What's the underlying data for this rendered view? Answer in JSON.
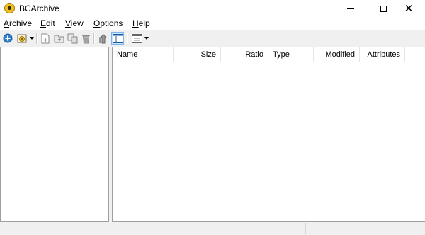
{
  "window": {
    "title": "BCArchive",
    "icon": "bcarchive-app-icon",
    "controls": [
      "minimize-icon",
      "maximize-icon",
      "close-icon"
    ]
  },
  "menu": {
    "items": [
      {
        "label": "Archive",
        "mnemonic": "A",
        "rest": "rchive"
      },
      {
        "label": "Edit",
        "mnemonic": "E",
        "rest": "dit"
      },
      {
        "label": "View",
        "mnemonic": "V",
        "rest": "iew"
      },
      {
        "label": "Options",
        "mnemonic": "O",
        "rest": "ptions"
      },
      {
        "label": "Help",
        "mnemonic": "H",
        "rest": "elp"
      }
    ]
  },
  "toolbar": {
    "buttons": [
      "new-archive-icon",
      "open-archive-icon",
      "open-dropdown-icon",
      "add-files-icon",
      "add-folder-icon",
      "extract-icon",
      "delete-icon",
      "up-folder-icon",
      "folder-pane-toggle-icon",
      "view-mode-icon",
      "view-mode-dropdown-icon"
    ]
  },
  "file_list": {
    "columns": [
      "Name",
      "Size",
      "Ratio",
      "Type",
      "Modified",
      "Attributes"
    ],
    "rows": []
  },
  "colors": {
    "titlebar": "#ffffff",
    "chrome": "#f0f0f0",
    "pane_border": "#a0a0a0",
    "active_button": "#cce4f7"
  }
}
